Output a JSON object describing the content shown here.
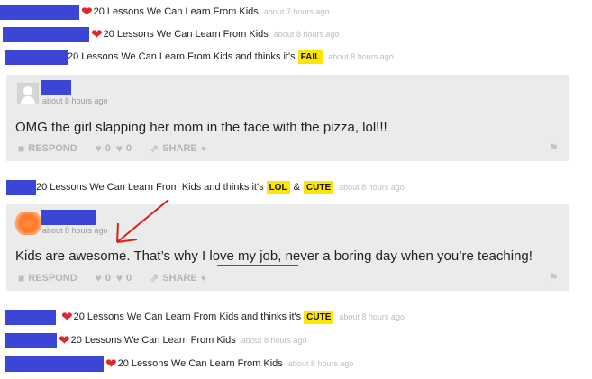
{
  "feed": {
    "activities": [
      {
        "text": "20 Lessons We Can Learn From Kids",
        "time": "about 7 hours ago"
      },
      {
        "text": "20 Lessons We Can Learn From Kids",
        "time": "about 8 hours ago"
      },
      {
        "text": "20 Lessons We Can Learn From Kids and thinks it's",
        "badge": "FAIL",
        "time": "about 8 hours ago"
      },
      {
        "text": "20 Lessons We Can Learn From Kids and thinks it's",
        "badge1": "LOL",
        "amp": "&",
        "badge2": "CUTE",
        "time": "about 8 hours ago"
      },
      {
        "text": "20 Lessons We Can Learn From Kids and thinks it's",
        "badge": "CUTE",
        "time": "about 8 hours ago"
      },
      {
        "text": "20 Lessons We Can Learn From Kids",
        "time": "about 8 hours ago"
      },
      {
        "text": "20 Lessons We Can Learn From Kids",
        "time": "about 8 hours ago"
      }
    ],
    "comments": [
      {
        "time": "about 8 hours ago",
        "text": "OMG the girl slapping her mom in the face with the pizza, lol!!!"
      },
      {
        "time": "about 8 hours ago",
        "text": "Kids are awesome. That’s why I love my job, never a boring day when you’re teaching!"
      }
    ],
    "actions": {
      "respond": "RESPOND",
      "likes": "0",
      "dislikes": "0",
      "share": "SHARE"
    }
  },
  "colors": {
    "heart": "#e0262b",
    "badge": "#ffe600",
    "redaction": "#3b45d6",
    "card": "#ebebeb",
    "annotation": "#e01b22"
  }
}
